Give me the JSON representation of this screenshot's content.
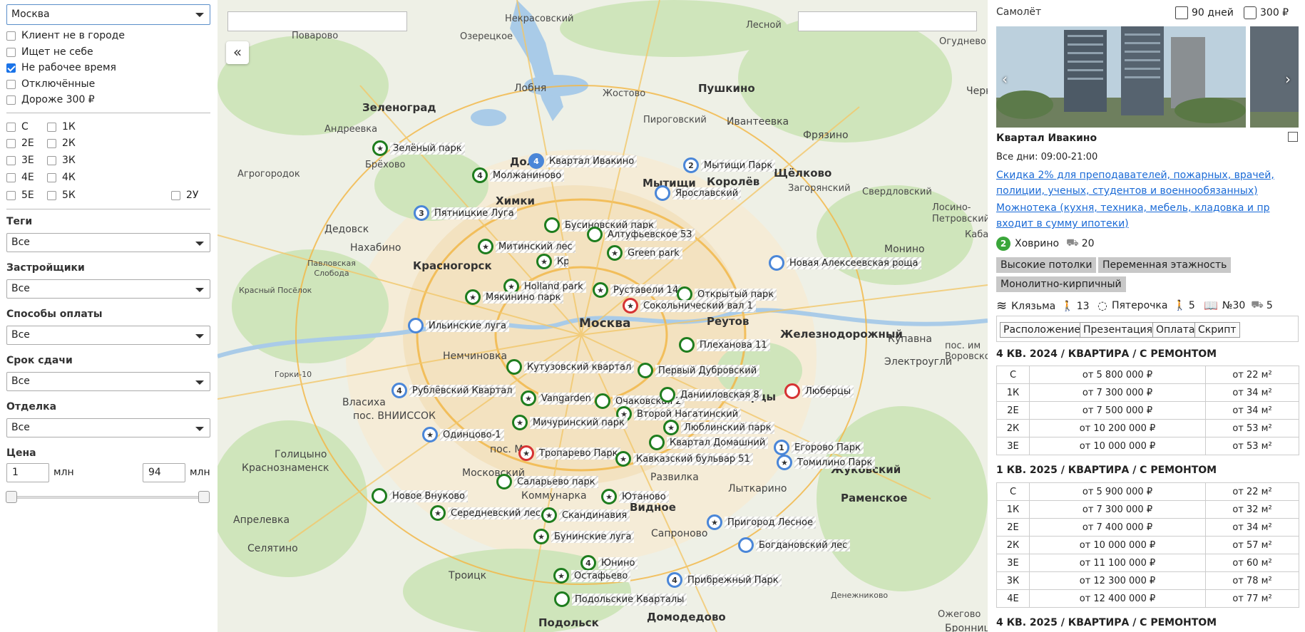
{
  "filters": {
    "city": "Москва",
    "checkboxes": [
      {
        "label": "Клиент не в городе",
        "checked": false
      },
      {
        "label": "Ищет не себе",
        "checked": false
      },
      {
        "label": "Не рабочее время",
        "checked": true
      },
      {
        "label": "Отключённые",
        "checked": false
      },
      {
        "label": "Дороже 300 ₽",
        "checked": false
      }
    ],
    "room_types": [
      "С",
      "1К",
      "2Е",
      "2К",
      "3Е",
      "3К",
      "4Е",
      "4К",
      "5Е",
      "5К",
      "2У"
    ],
    "tags_label": "Теги",
    "tags_value": "Все",
    "developers_label": "Застройщики",
    "developers_value": "Все",
    "payment_label": "Способы оплаты",
    "payment_value": "Все",
    "deadline_label": "Срок сдачи",
    "deadline_value": "Все",
    "finishing_label": "Отделка",
    "finishing_value": "Все",
    "price_label": "Цена",
    "price_min": "1",
    "price_max": "94",
    "price_unit": "млн",
    "price_range": {
      "min": 1,
      "max": 94
    }
  },
  "map": {
    "collapse_label": "«",
    "places": [
      {
        "text": "Зеленоград",
        "cls": "big"
      },
      {
        "text": "Андреевка"
      },
      {
        "text": "Брёхово"
      },
      {
        "text": "Поварово"
      },
      {
        "text": "Озерецкое"
      },
      {
        "text": "Некрасовский"
      },
      {
        "text": "Лесной"
      },
      {
        "text": "Огудневo"
      },
      {
        "text": "Пушкино",
        "cls": "big"
      },
      {
        "text": "Лобня"
      },
      {
        "text": "Жостово"
      },
      {
        "text": "Ивантеевка"
      },
      {
        "text": "Пироговский"
      },
      {
        "text": "Фрязино"
      },
      {
        "text": "Щёлково",
        "cls": "big"
      },
      {
        "text": "Загорянский"
      },
      {
        "text": "Свердловский"
      },
      {
        "text": "Лосино-Петровский"
      },
      {
        "text": "Химки",
        "cls": "big"
      },
      {
        "text": "Мытищи",
        "cls": "big"
      },
      {
        "text": "Королёв",
        "cls": "big"
      },
      {
        "text": "Долгопрудный",
        "cls": "big"
      },
      {
        "text": "Агрогородок"
      },
      {
        "text": "Дедовск"
      },
      {
        "text": "Нахабино"
      },
      {
        "text": "Павловская Слобода"
      },
      {
        "text": "Красногорск",
        "cls": "big"
      },
      {
        "text": "Красный Посёлок"
      },
      {
        "text": "Монино"
      },
      {
        "text": "Москва",
        "cls": "big"
      },
      {
        "text": "Реутов",
        "cls": "big"
      },
      {
        "text": "Железнодорожный",
        "cls": "big"
      },
      {
        "text": "Купавна"
      },
      {
        "text": "Электроугли"
      },
      {
        "text": "пос. им Воровского"
      },
      {
        "text": "Немчиновка"
      },
      {
        "text": "Горки-10"
      },
      {
        "text": "Власиха"
      },
      {
        "text": "пос. ВНИИССОК"
      },
      {
        "text": "Голицыно"
      },
      {
        "text": "Краснознаменск"
      },
      {
        "text": "Люберцы",
        "cls": "big"
      },
      {
        "text": "Жуковский",
        "cls": "big"
      },
      {
        "text": "пос. М"
      },
      {
        "text": "Московский"
      },
      {
        "text": "Коммунарка"
      },
      {
        "text": "Развилка"
      },
      {
        "text": "Видное",
        "cls": "big"
      },
      {
        "text": "Лыткарино"
      },
      {
        "text": "Раменское",
        "cls": "big"
      },
      {
        "text": "Апрелевка"
      },
      {
        "text": "Селятино"
      },
      {
        "text": "Сапроново"
      },
      {
        "text": "Троицк"
      },
      {
        "text": "Домодедово",
        "cls": "big"
      },
      {
        "text": "Подольск",
        "cls": "big"
      },
      {
        "text": "Денежниково"
      },
      {
        "text": "Бронницы"
      },
      {
        "text": "Черн"
      },
      {
        "text": "Кабанова"
      },
      {
        "text": "Ожегово"
      }
    ],
    "markers": [
      {
        "label": "Зелёный парк",
        "kind": "star",
        "color": "green"
      },
      {
        "label": "Молжаниново",
        "num": "4",
        "color": "green"
      },
      {
        "label": "Квартал Ивакино",
        "num": "4",
        "color": "fill"
      },
      {
        "label": "Мытищи Парк",
        "num": "2",
        "color": "blue"
      },
      {
        "label": "Ярославский",
        "color": "blue"
      },
      {
        "label": "Пятницкие Луга",
        "num": "3",
        "color": "blue"
      },
      {
        "label": "Бусиновский парк",
        "color": "green"
      },
      {
        "label": "Алтуфьевское 53",
        "color": "green"
      },
      {
        "label": "Митинский лес",
        "kind": "star",
        "color": "green"
      },
      {
        "label": "Green park",
        "kind": "star",
        "color": "green"
      },
      {
        "label": "Кронштадтский",
        "kind": "star",
        "color": "green"
      },
      {
        "label": "Новая Алексеевская роща",
        "color": "blue"
      },
      {
        "label": "Holland park",
        "kind": "star",
        "color": "green"
      },
      {
        "label": "Руставели 14",
        "kind": "star",
        "color": "green"
      },
      {
        "label": "Открытый парк",
        "color": "green"
      },
      {
        "label": "Мякинино парк",
        "kind": "star",
        "color": "green"
      },
      {
        "label": "Сокольнический вал 1",
        "kind": "star",
        "color": "red"
      },
      {
        "label": "Ильинские луга",
        "color": "blue"
      },
      {
        "label": "Плеханова 11",
        "color": "green"
      },
      {
        "label": "Кутузовский квартал",
        "color": "green"
      },
      {
        "label": "Первый Дубровский",
        "color": "green"
      },
      {
        "label": "Рублёвский Квартал",
        "num": "4",
        "color": "blue"
      },
      {
        "label": "Люберцы",
        "color": "red"
      },
      {
        "label": "Vangarden",
        "kind": "star",
        "color": "green"
      },
      {
        "label": "Очаковская 2",
        "color": "green"
      },
      {
        "label": "Данииловская 8",
        "color": "green"
      },
      {
        "label": "Второй Нагатинский",
        "kind": "star",
        "color": "green"
      },
      {
        "label": "Мичуринский парк",
        "kind": "star",
        "color": "green"
      },
      {
        "label": "Одинцово-1",
        "kind": "star",
        "color": "blue"
      },
      {
        "label": "Люблинский парк",
        "kind": "star",
        "color": "green"
      },
      {
        "label": "Квартал Домашний",
        "color": "green"
      },
      {
        "label": "Егорово Парк",
        "num": "1",
        "color": "blue"
      },
      {
        "label": "Томилино Парк",
        "kind": "star",
        "color": "blue"
      },
      {
        "label": "Тропарево Парк",
        "kind": "star",
        "color": "red"
      },
      {
        "label": "Кавказский бульвар 51",
        "kind": "star",
        "color": "green"
      },
      {
        "label": "Саларьево парк",
        "color": "green"
      },
      {
        "label": "Новое Внуково",
        "color": "green"
      },
      {
        "label": "Ютаново",
        "kind": "star",
        "color": "green"
      },
      {
        "label": "Середневский лес",
        "kind": "star",
        "color": "green"
      },
      {
        "label": "Скандинавия",
        "kind": "star",
        "color": "green"
      },
      {
        "label": "Пригород Лесное",
        "kind": "star",
        "color": "blue"
      },
      {
        "label": "Бунинские луга",
        "kind": "star",
        "color": "green"
      },
      {
        "label": "Богдановский лес",
        "color": "blue"
      },
      {
        "label": "Юнино",
        "num": "4",
        "color": "green"
      },
      {
        "label": "Остафьево",
        "kind": "star",
        "color": "green"
      },
      {
        "label": "Прибрежный Парк",
        "num": "4",
        "color": "blue"
      },
      {
        "label": "Подольские Кварталы",
        "color": "green"
      }
    ]
  },
  "detail": {
    "developer": "Самолёт",
    "days": "90 дней",
    "cost": "300 ₽",
    "prev_arrow": "‹",
    "next_arrow": "›",
    "title": "Квартал Ивакино",
    "hours": "Все дни: 09:00-21:00",
    "promo1": "Скидка 2% для преподавателей, пожарных, врачей, полиции, ученых, студентов и военнообязанных)",
    "promo2": "Можнотека (кухня, техника, мебель, кладовка и пр входит в сумму ипотеки)",
    "metro_num": "2",
    "metro_name": "Ховрино",
    "metro_time": "20",
    "tags": [
      "Высокие потолки",
      "Переменная этажность",
      "Монолитно-кирпичный"
    ],
    "poi_river": "Клязьма",
    "poi_river_time": "13",
    "poi_shop": "Пятерочка",
    "poi_shop_time": "5",
    "poi_school": "№30",
    "poi_school_time": "5",
    "tabs": [
      "Расположение",
      "Презентация",
      "Оплата",
      "Скрипт"
    ],
    "sections": [
      {
        "title": "4 КВ. 2024 / КВАРТИРА / С РЕМОНТОМ",
        "rows": [
          [
            "С",
            "от 5 800 000 ₽",
            "от 22 м²"
          ],
          [
            "1К",
            "от 7 300 000 ₽",
            "от 34 м²"
          ],
          [
            "2Е",
            "от 7 500 000 ₽",
            "от 34 м²"
          ],
          [
            "2К",
            "от 10 200 000 ₽",
            "от 53 м²"
          ],
          [
            "3Е",
            "от 10 000 000 ₽",
            "от 53 м²"
          ]
        ]
      },
      {
        "title": "1 КВ. 2025 / КВАРТИРА / С РЕМОНТОМ",
        "rows": [
          [
            "С",
            "от 5 900 000 ₽",
            "от 22 м²"
          ],
          [
            "1К",
            "от 7 300 000 ₽",
            "от 32 м²"
          ],
          [
            "2Е",
            "от 7 400 000 ₽",
            "от 34 м²"
          ],
          [
            "2К",
            "от 10 000 000 ₽",
            "от 57 м²"
          ],
          [
            "3Е",
            "от 11 100 000 ₽",
            "от 60 м²"
          ],
          [
            "3К",
            "от 12 300 000 ₽",
            "от 78 м²"
          ],
          [
            "4Е",
            "от 12 400 000 ₽",
            "от 77 м²"
          ]
        ]
      },
      {
        "title": "4 КВ. 2025 / КВАРТИРА / С РЕМОНТОМ",
        "rows": []
      }
    ]
  },
  "colors": {
    "green": "#1e7d1e",
    "blue": "#4a86d8",
    "red": "#d63333",
    "link": "#1a6ad6",
    "tag_bg": "#c8c8c8"
  }
}
